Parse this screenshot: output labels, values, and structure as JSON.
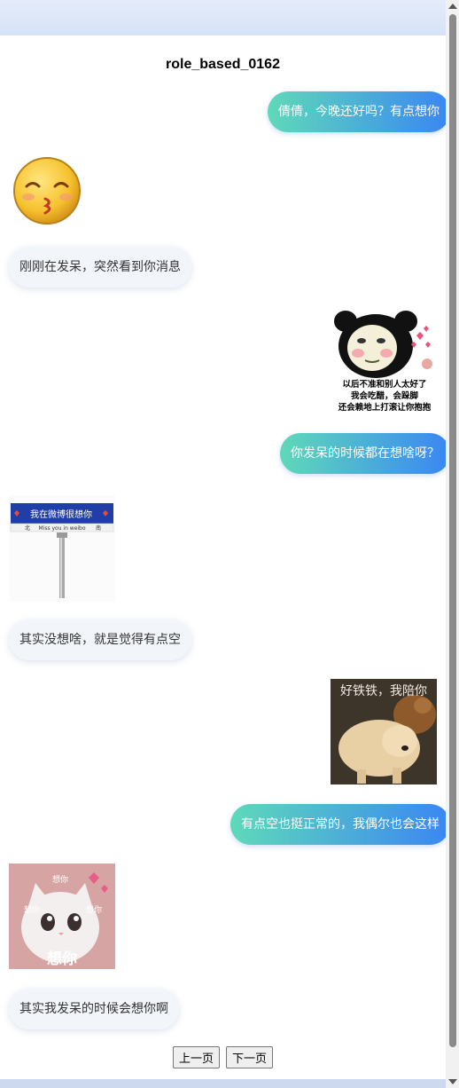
{
  "chat": {
    "title": "role_based_0162",
    "messages": [
      {
        "role": "user",
        "type": "text",
        "text": "倩倩，今晚还好吗？有点想你"
      },
      {
        "role": "bot",
        "type": "sticker",
        "sticker": "kissing-face-emoji"
      },
      {
        "role": "bot",
        "type": "text",
        "text": "刚刚在发呆，突然看到你消息"
      },
      {
        "role": "user",
        "type": "sticker",
        "sticker": "panda-meme-sticker",
        "caption_lines": [
          "以后不准和别人太好了",
          "我会吃醋，会跺脚",
          "还会赖地上打滚让你抱抱"
        ]
      },
      {
        "role": "user",
        "type": "text",
        "text": "你发呆的时候都在想啥呀？"
      },
      {
        "role": "bot",
        "type": "sticker",
        "sticker": "weibo-sign-sticker",
        "sign_text": "我在微博很想你",
        "sign_sub": "Miss you in weibo",
        "sign_left": "北",
        "sign_right": "南"
      },
      {
        "role": "bot",
        "type": "text",
        "text": "其实没想啥，就是觉得有点空"
      },
      {
        "role": "user",
        "type": "sticker",
        "sticker": "dogs-photo-sticker",
        "caption": "好铁铁，我陪你"
      },
      {
        "role": "user",
        "type": "text",
        "text": "有点空也挺正常的，我偶尔也会这样"
      },
      {
        "role": "bot",
        "type": "sticker",
        "sticker": "cat-miss-you-sticker",
        "labels": [
          "想你",
          "想你",
          "想你",
          "想你"
        ]
      },
      {
        "role": "bot",
        "type": "text",
        "text": "其实我发呆的时候会想你啊"
      }
    ]
  },
  "pagination": {
    "prev_label": "上一页",
    "next_label": "下一页"
  },
  "colors": {
    "user_gradient_start": "#5fd9b9",
    "user_gradient_end": "#3a86f3",
    "bot_bubble": "#f2f5fa",
    "background": "#dde7f7"
  }
}
